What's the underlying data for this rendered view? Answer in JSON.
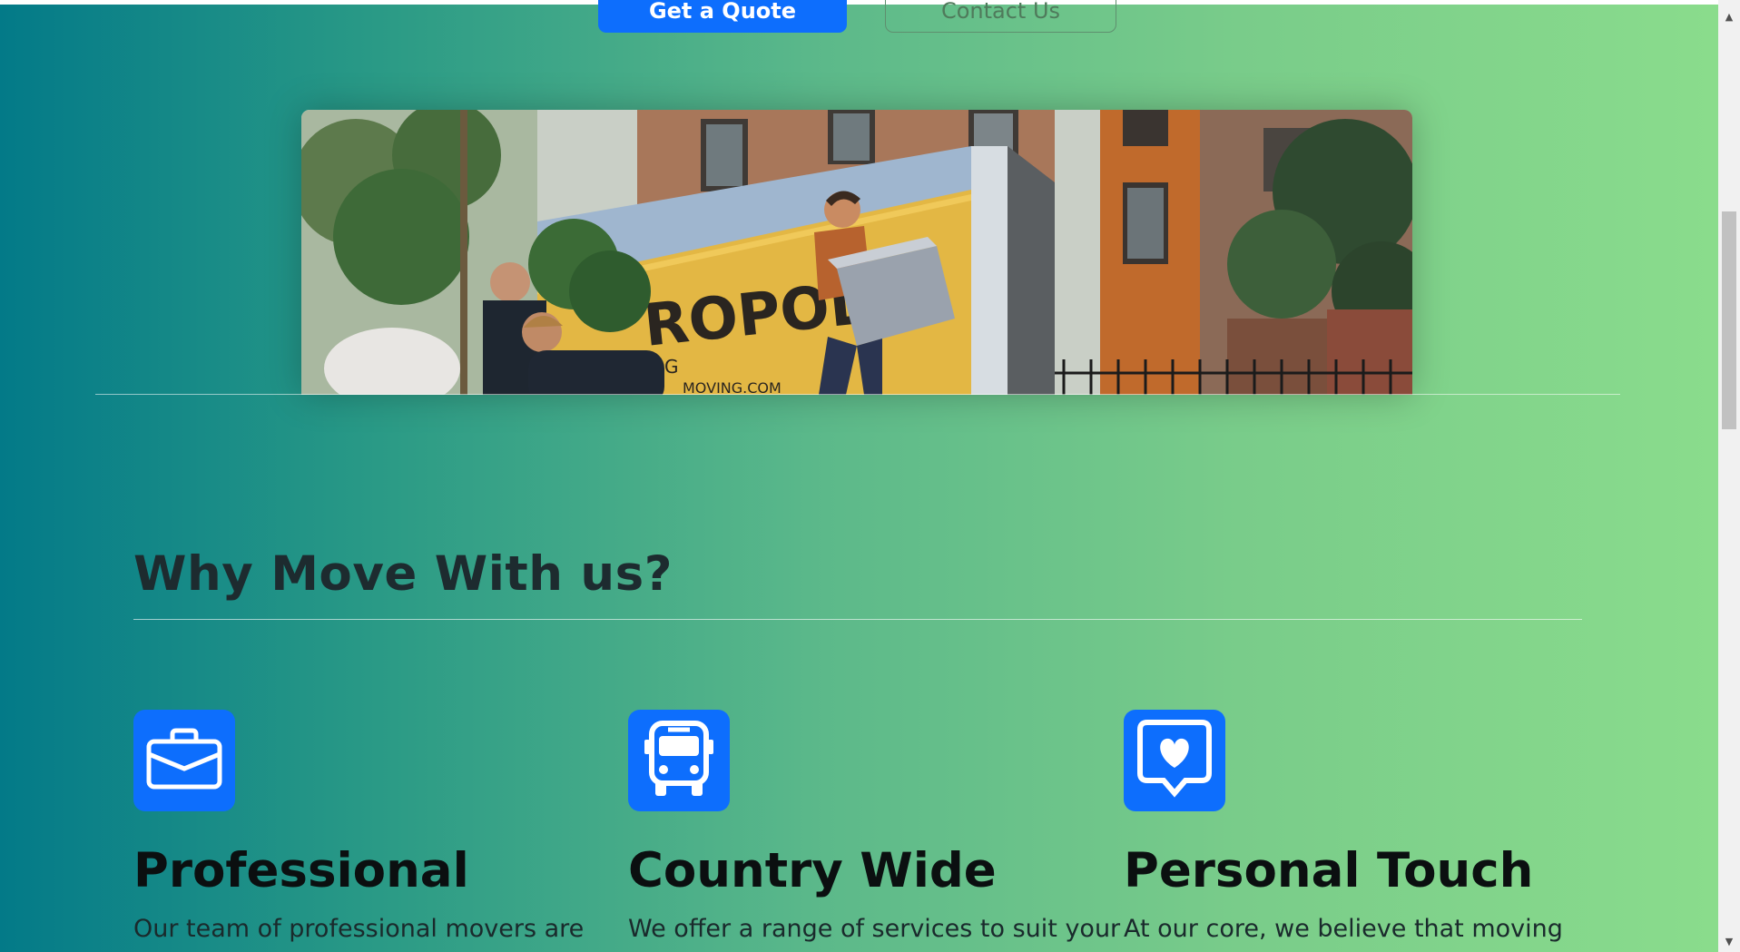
{
  "hero": {
    "quote_button_label": "Get a Quote",
    "contact_button_label": "Contact Us",
    "truck_text": "ROPOLIS",
    "truck_subtext": "G",
    "truck_url": "MOVING.COM"
  },
  "why_section": {
    "title": "Why Move With us?",
    "features": [
      {
        "icon": "briefcase-icon",
        "title": "Professional",
        "text": "Our team of professional movers are"
      },
      {
        "icon": "bus-icon",
        "title": "Country Wide",
        "text": "We offer a range of services to suit your"
      },
      {
        "icon": "chat-heart-icon",
        "title": "Personal Touch",
        "text": "At our core, we believe that moving"
      }
    ]
  },
  "colors": {
    "accent": "#0d6efd",
    "gradient_start": "#037a88",
    "gradient_end": "#8adc8c"
  }
}
